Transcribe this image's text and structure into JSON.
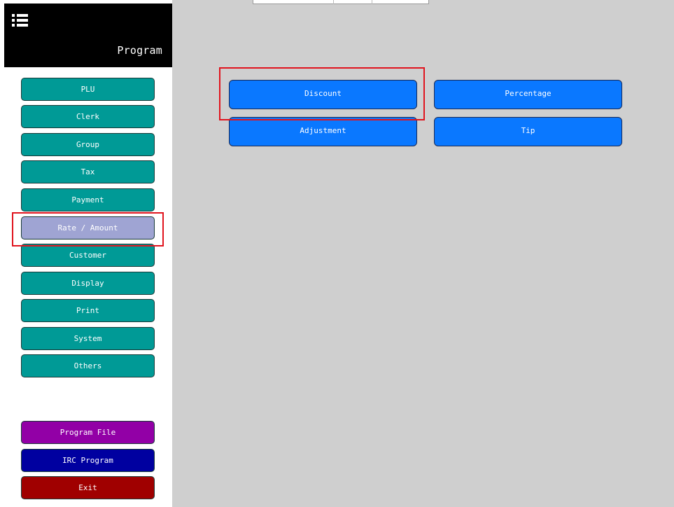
{
  "header": {
    "title": "Program",
    "menu_icon": "list-menu-icon"
  },
  "sidebar": {
    "items": [
      {
        "label": "PLU"
      },
      {
        "label": "Clerk"
      },
      {
        "label": "Group"
      },
      {
        "label": "Tax"
      },
      {
        "label": "Payment"
      },
      {
        "label": "Rate / Amount",
        "active": true
      },
      {
        "label": "Customer"
      },
      {
        "label": "Display"
      },
      {
        "label": "Print"
      },
      {
        "label": "System"
      },
      {
        "label": "Others"
      }
    ],
    "footer_items": [
      {
        "label": "Program File"
      },
      {
        "label": "IRC Program"
      },
      {
        "label": "Exit"
      }
    ]
  },
  "main": {
    "options": [
      {
        "label": "Discount"
      },
      {
        "label": "Percentage"
      },
      {
        "label": "Adjustment"
      },
      {
        "label": "Tip"
      }
    ]
  },
  "colors": {
    "teal": "#009a96",
    "active": "#9fa4d3",
    "purple": "#9200a6",
    "navy": "#0000a0",
    "maroon": "#a00000",
    "option_blue": "#0a78ff",
    "main_bg": "#cfcfcf",
    "highlight": "#e0141e"
  }
}
